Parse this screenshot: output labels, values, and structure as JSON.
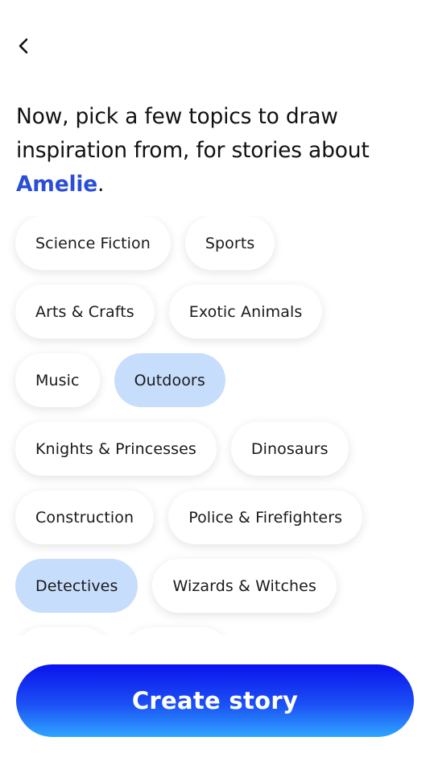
{
  "nav": {
    "back_icon": "chevron-left-icon"
  },
  "prompt": {
    "text": "Now, pick a few topics to draw inspiration from, for stories about ",
    "name": "Amelie",
    "punctuation": ".",
    "name_color": "#2a4fd6"
  },
  "topics": [
    {
      "label": "Science Fiction",
      "selected": false
    },
    {
      "label": "Sports",
      "selected": false
    },
    {
      "label": "Arts & Crafts",
      "selected": false
    },
    {
      "label": "Exotic Animals",
      "selected": false
    },
    {
      "label": "Music",
      "selected": false
    },
    {
      "label": "Outdoors",
      "selected": true
    },
    {
      "label": "Knights & Princesses",
      "selected": false
    },
    {
      "label": "Dinosaurs",
      "selected": false
    },
    {
      "label": "Construction",
      "selected": false
    },
    {
      "label": "Police & Firefighters",
      "selected": false
    },
    {
      "label": "Detectives",
      "selected": true
    },
    {
      "label": "Wizards & Witches",
      "selected": false
    },
    {
      "label": "",
      "selected": false
    },
    {
      "label": "",
      "selected": false
    }
  ],
  "colors": {
    "selected_chip": "#c7ddfc",
    "chip": "#ffffff",
    "button_gradient_top": "#0a12ee",
    "button_gradient_bottom": "#2ea6ff"
  },
  "actions": {
    "create_label": "Create story"
  }
}
